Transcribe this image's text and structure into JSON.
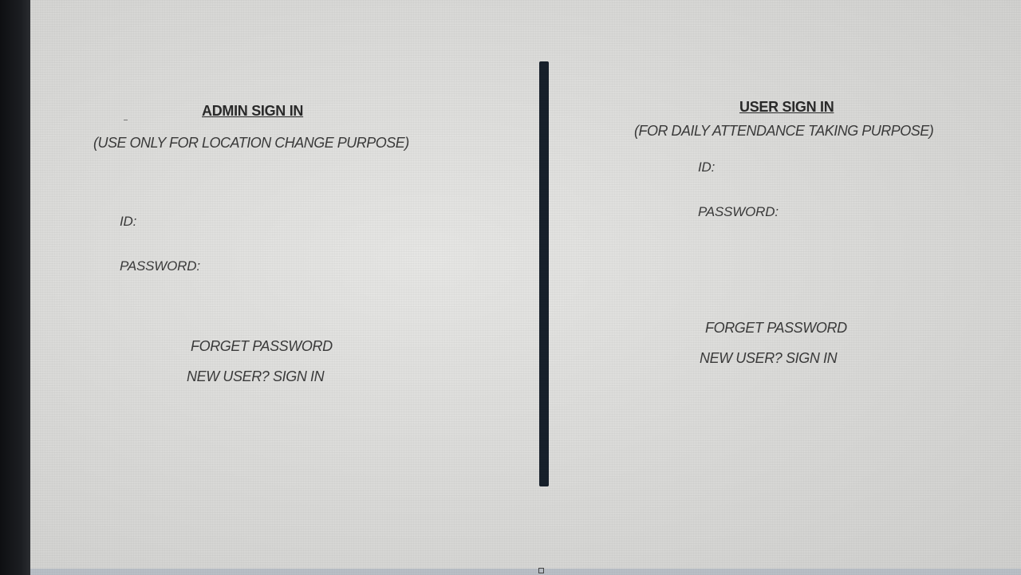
{
  "admin": {
    "title": "ADMIN SIGN IN",
    "subtitle": "(USE ONLY FOR LOCATION CHANGE PURPOSE)",
    "id_label": "ID:",
    "password_label": "PASSWORD:",
    "forget_password": "FORGET PASSWORD",
    "new_user": "NEW USER? SIGN IN"
  },
  "user": {
    "title": "USER SIGN IN",
    "subtitle": "(FOR DAILY ATTENDANCE TAKING PURPOSE)",
    "id_label": "ID:",
    "password_label": "PASSWORD:",
    "forget_password": "FORGET PASSWORD",
    "new_user": "NEW USER? SIGN IN"
  },
  "colors": {
    "divider": "#17202b",
    "text": "#3a3a3a",
    "background": "#dcdcda"
  },
  "icons": {
    "window-control": "square-icon"
  }
}
